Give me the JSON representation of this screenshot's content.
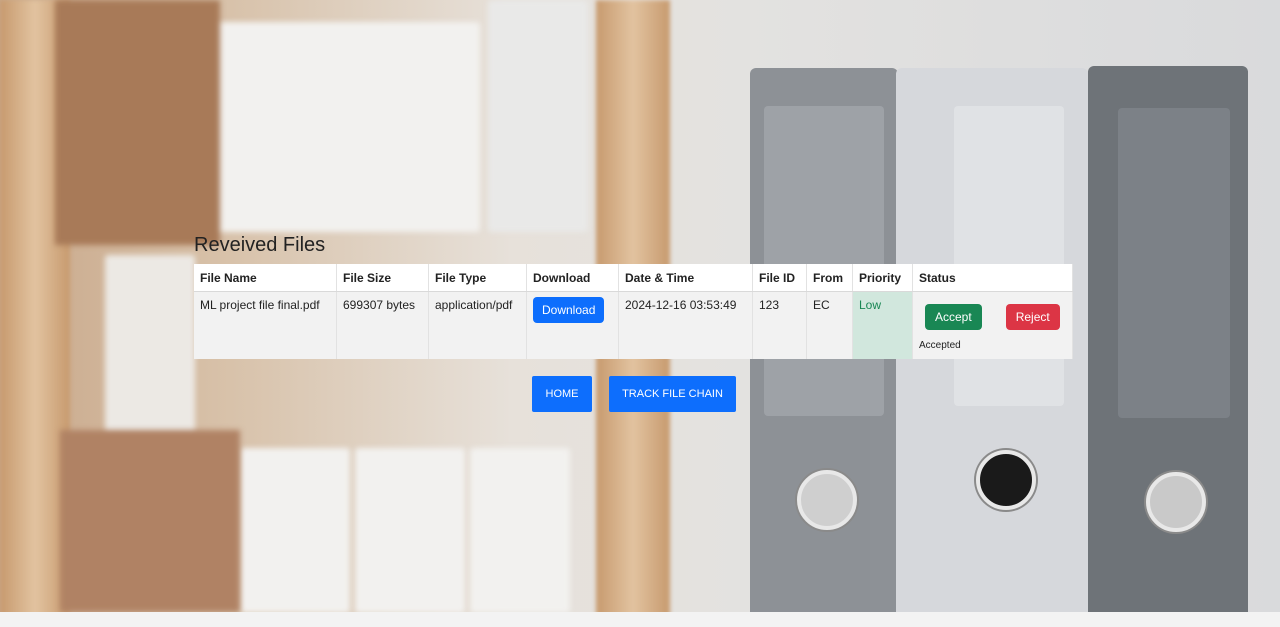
{
  "page": {
    "heading": "Reveived Files"
  },
  "table": {
    "headers": [
      "File Name",
      "File Size",
      "File Type",
      "Download",
      "Date & Time",
      "File ID",
      "From",
      "Priority",
      "Status"
    ],
    "rows": [
      {
        "file_name": "ML project file final.pdf",
        "file_size": "699307 bytes",
        "file_type": "application/pdf",
        "download_label": "Download",
        "date_time": "2024-12-16 03:53:49",
        "file_id": "123",
        "from": "EC",
        "priority": "Low",
        "accept_label": "Accept",
        "reject_label": "Reject",
        "status": "Accepted"
      }
    ]
  },
  "nav": {
    "home_label": "HOME",
    "track_label": "TRACK FILE CHAIN"
  },
  "colors": {
    "primary": "#0d6efd",
    "accept": "#198754",
    "reject": "#dc3545",
    "priority_bg": "#d1e7dd"
  }
}
